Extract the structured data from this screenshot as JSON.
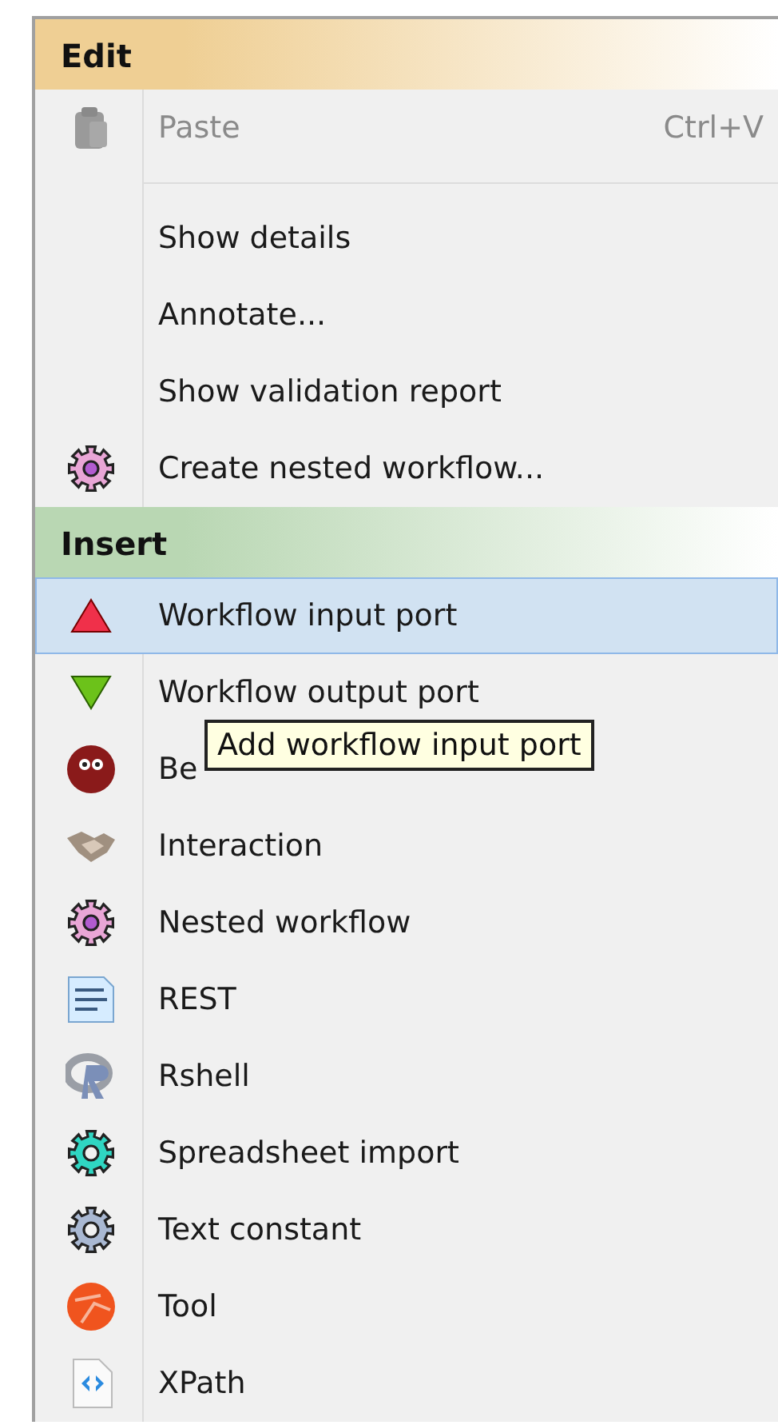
{
  "sections": [
    {
      "title": "Edit",
      "color": "#efcf94",
      "items": [
        {
          "kind": "item",
          "label": "Paste",
          "shortcut": "Ctrl+V",
          "disabled": true,
          "selected": false
        },
        {
          "kind": "separator"
        },
        {
          "kind": "item",
          "label": "Show details",
          "disabled": false,
          "selected": false
        },
        {
          "kind": "item",
          "label": "Annotate...",
          "disabled": false,
          "selected": false
        },
        {
          "kind": "item",
          "label": "Show validation report",
          "disabled": false,
          "selected": false
        },
        {
          "kind": "item",
          "label": "Create nested workflow...",
          "disabled": false,
          "selected": false
        }
      ]
    },
    {
      "title": "Insert",
      "color": "#b9d7b3",
      "items": [
        {
          "kind": "item",
          "label": "Workflow input port",
          "disabled": false,
          "selected": true
        },
        {
          "kind": "item",
          "label": "Workflow output port",
          "disabled": false,
          "selected": false
        },
        {
          "kind": "item",
          "label": "Be",
          "disabled": false,
          "selected": false
        },
        {
          "kind": "item",
          "label": "Interaction",
          "disabled": false,
          "selected": false
        },
        {
          "kind": "item",
          "label": "Nested workflow",
          "disabled": false,
          "selected": false
        },
        {
          "kind": "item",
          "label": "REST",
          "disabled": false,
          "selected": false
        },
        {
          "kind": "item",
          "label": "Rshell",
          "disabled": false,
          "selected": false
        },
        {
          "kind": "item",
          "label": "Spreadsheet import",
          "disabled": false,
          "selected": false
        },
        {
          "kind": "item",
          "label": "Text constant",
          "disabled": false,
          "selected": false
        },
        {
          "kind": "item",
          "label": "Tool",
          "disabled": false,
          "selected": false
        },
        {
          "kind": "item",
          "label": "XPath",
          "disabled": false,
          "selected": false
        }
      ]
    }
  ],
  "tooltip": "Add workflow input port"
}
